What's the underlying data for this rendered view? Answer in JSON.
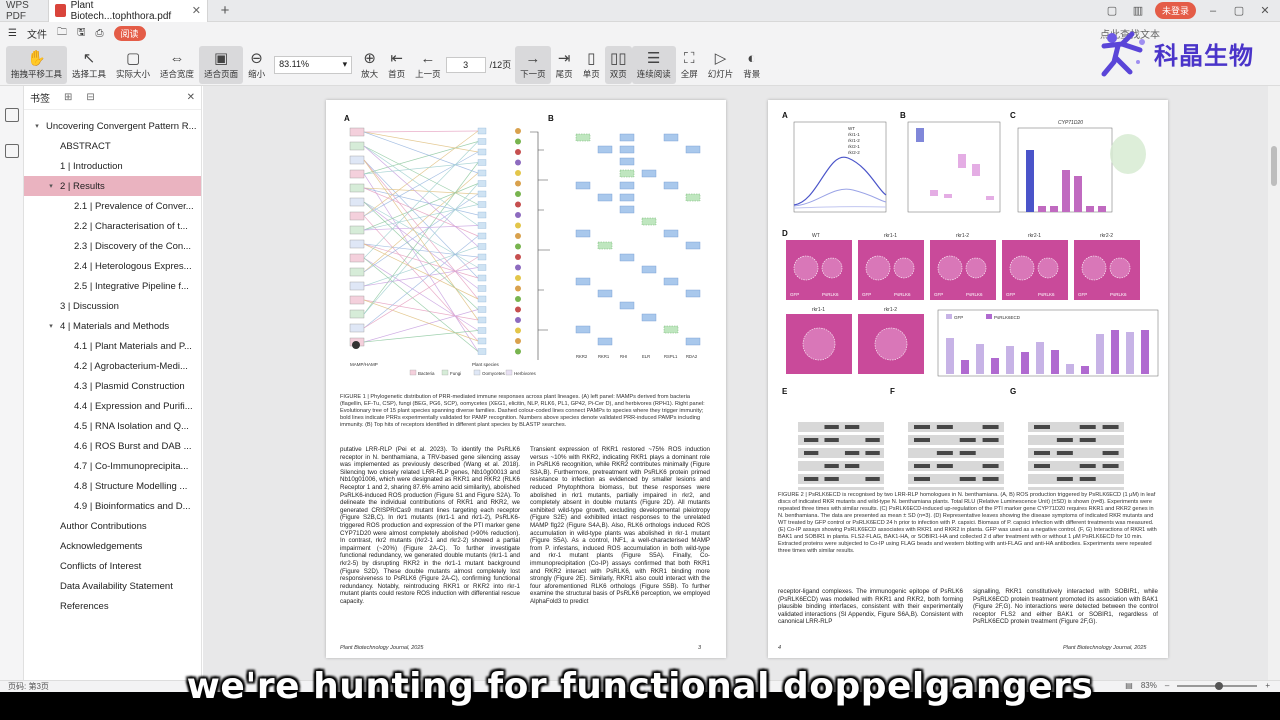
{
  "tabbar": {
    "app_label": "WPS PDF",
    "doc_tab": "Plant Biotech...tophthora.pdf",
    "login": "未登录"
  },
  "menubar": {
    "file": "文件",
    "read_mode": "阅读",
    "right_search": "点此查找文本"
  },
  "toolbar": {
    "tools": [
      {
        "name": "hand-tool",
        "glyph": "✋",
        "label": "拖拽平移工具",
        "active": true
      },
      {
        "name": "select-tool",
        "glyph": "↖",
        "label": "选择工具"
      },
      {
        "name": "actual-size",
        "glyph": "▢",
        "label": "实际大小"
      },
      {
        "name": "fit-width",
        "glyph": "⇔",
        "label": "适合宽度"
      },
      {
        "name": "fit-page",
        "glyph": "▣",
        "label": "适合页面",
        "active": true
      },
      {
        "name": "zoom-out",
        "glyph": "⊖",
        "label": "缩小"
      }
    ],
    "zoom_value": "83.11%",
    "tools2": [
      {
        "name": "zoom-in",
        "glyph": "⊕",
        "label": "放大"
      },
      {
        "name": "first-page",
        "glyph": "⇤",
        "label": "首页"
      },
      {
        "name": "prev-page",
        "glyph": "←",
        "label": "上一页"
      }
    ],
    "page_current": "3",
    "page_total": "/12页",
    "tools3": [
      {
        "name": "next-page",
        "glyph": "→",
        "label": "下一页",
        "active": true
      },
      {
        "name": "last-page",
        "glyph": "⇥",
        "label": "尾页"
      },
      {
        "name": "single-page",
        "glyph": "▯",
        "label": "单页"
      },
      {
        "name": "double-page",
        "glyph": "▯▯",
        "label": "双页",
        "active": true
      },
      {
        "name": "continuous",
        "glyph": "☰",
        "label": "连续阅读",
        "active": true
      },
      {
        "name": "fullscreen",
        "glyph": "⛶",
        "label": "全屏"
      },
      {
        "name": "slideshow",
        "glyph": "▷",
        "label": "幻灯片"
      },
      {
        "name": "background",
        "glyph": "◐",
        "label": "背景"
      }
    ]
  },
  "logo": {
    "text": "科晶生物"
  },
  "bookmarks": {
    "header": "书签",
    "items": [
      {
        "label": "Uncovering Convergent Pattern R...",
        "level": 0,
        "arrow": "▾"
      },
      {
        "label": "ABSTRACT",
        "level": 1
      },
      {
        "label": "1  |  Introduction",
        "level": 1
      },
      {
        "label": "2  |  Results",
        "level": 1,
        "arrow": "▾",
        "selected": true
      },
      {
        "label": "2.1  |  Prevalence of Conver...",
        "level": 2
      },
      {
        "label": "2.2  |  Characterisation of t...",
        "level": 2
      },
      {
        "label": "2.3  |  Discovery of the Con...",
        "level": 2
      },
      {
        "label": "2.4  |  Heterologous Expres...",
        "level": 2
      },
      {
        "label": "2.5  |  Integrative Pipeline f...",
        "level": 2
      },
      {
        "label": "3  |  Discussion",
        "level": 1
      },
      {
        "label": "4  |  Materials and Methods",
        "level": 1,
        "arrow": "▾"
      },
      {
        "label": "4.1  |  Plant Materials and P...",
        "level": 2
      },
      {
        "label": "4.2  |  Agrobacterium-Medi...",
        "level": 2
      },
      {
        "label": "4.3  |  Plasmid Construction",
        "level": 2
      },
      {
        "label": "4.4  |  Expression and Purifi...",
        "level": 2
      },
      {
        "label": "4.5  |  RNA Isolation and Q...",
        "level": 2
      },
      {
        "label": "4.6  |  ROS Burst and DAB ...",
        "level": 2
      },
      {
        "label": "4.7  |  Co-Immunoprecipita...",
        "level": 2
      },
      {
        "label": "4.8  |  Structure Modelling ...",
        "level": 2
      },
      {
        "label": "4.9  |  Bioinformatics and D...",
        "level": 2
      },
      {
        "label": "Author Contributions",
        "level": 1
      },
      {
        "label": "Acknowledgements",
        "level": 1
      },
      {
        "label": "Conflicts of Interest",
        "level": 1
      },
      {
        "label": "Data Availability Statement",
        "level": 1
      },
      {
        "label": "References",
        "level": 1
      }
    ]
  },
  "page_left": {
    "panel_a": "A",
    "panel_b": "B",
    "fig_caption": "FIGURE 1  |  Phylogenetic distribution of PRR-mediated immune responses across plant lineages. (A) left panel: MAMPs derived from bacteria (flagellin, EF-Tu, CSP), fungi (BEG, PG6, SCP), oomycetes (XEG1, elicitin, NLP, RLK6, PL1, GP42, Pi-Cer D), and herbivores (RPH1). Right panel: Evolutionary tree of 15 plant species spanning diverse families. Dashed colour-coded lines connect PAMPs to species where they trigger immunity; bold lines indicate PRRs experimentally validated for PAMP recognition. Numbers above species denote validated PRR-induced PAMPs including immunity. (B) Top hits of receptors identified in different plant species by BLASTP searches.",
    "col1": "putative LRR-RLP (Pei et al. 2023). To identify the PsRLK6 receptor in N. benthamiana, a TRV-based gene silencing assay was implemented as previously described (Wang et al. 2018). Silencing two closely related LRR-RLP genes, Nb10g00013 and Nb10g01006, which were designated as RKR1 and RKR2 (RLK6 Receptor 1 and 2, sharing 87.6% amino acid similarity), abolished PsRLK6-induced ROS production (Figure S1 and Figure S2A). To delineate the individual contributions of RKR1 and RKR2, we generated CRISPR/Cas9 mutant lines targeting each receptor (Figure S2B,C). In rkr1 mutants (rkr1-1 and rkr1-2), PsRLK6-triggered ROS production and expression of the PTI marker gene CYP71D20 were almost completely abolished (>90% reduction). In contrast, rkr2 mutants (rkr2-1 and rkr2-2) showed a partial impairment (~20%) (Figure 2A-C). To further investigate functional redundancy, we generated double mutants (rkr1-1 and rkr2-5) by disrupting RKR2 in the rkr1-1 mutant background (Figure S2D). These double mutants almost completely lost responsiveness to PsRLK6 (Figure 2A-C), confirming functional redundancy. Notably, reintroducing RKR1 or RKR2 into rkr-1 mutant plants could restore ROS induction with differential rescue capacity.",
    "col2": "Transient expression of RKR1 restored ~75% ROS induction versus ~10% with RKR2, indicating RKR1 plays a dominant role in PsRLK6 recognition, while RKR2 contributes minimally (Figure S3A,B). Furthermore, pretreatment with PsRLK6 protein primed resistance to infection as evidenced by smaller lesions and reduced Phytophthora biomass, but these responses were abolished in rkr1 mutants, partially impaired in rkr2, and completely absent in double mutants (Figure 2D). All mutants exhibited wild-type growth, excluding developmental pleiotropy (Figure S2E) and exhibited intact responses to the unrelated MAMP flg22 (Figure S4A,B). Also, RLK6 orthologs induced ROS accumulation in wild-type plants was abolished in rkr-1 mutant (Figure S5A). As a control, INF1, a well-characterised MAMP from P. infestans, induced ROS accumulation in both wild-type and rkr-1 mutant plants (Figure S5A). Finally, Co-immunoprecipitation (Co-IP) assays confirmed that both RKR1 and RKR2 interact with PsRLK6, with RKR1 binding more strongly (Figure 2E). Similarly, RKR1 also could interact with the four aforementioned RLK6 orthologs (Figure S5B). To further examine the structural basis of PsRLK6 perception, we employed AlphaFold3 to predict",
    "footer_journal": "Plant Biotechnology Journal, 2025",
    "footer_num": "3",
    "legend_items": [
      "Bacteria",
      "Fungi",
      "Oomycetes",
      "Herbivores"
    ],
    "xaxis_labels": [
      "RKR2",
      "RKR1",
      "RHI",
      "ELR",
      "RSPL1",
      "RDA2"
    ],
    "mamp_label": "MAMP/HAMP",
    "species_label": "Plant species"
  },
  "page_right": {
    "panel_labels": [
      "A",
      "B",
      "C",
      "D",
      "E",
      "F",
      "G"
    ],
    "fig_caption": "FIGURE 2  |  PsRLK6ECD is recognised by two LRR-RLP homologues in N. benthamiana. (A, B) ROS production triggered by PsRLK6ECD (1 μM) in leaf discs of indicated RKR mutants and wild-type N. benthamiana plants. Total RLU (Relative Luminescence Unit) (±SD) is shown (n=8). Experiments were repeated three times with similar results. (C) PsRLK6ECD-induced up-regulation of the PTI marker gene CYP71D20 requires RKR1 and RKR2 genes in N. benthamiana. The data are presented as mean ± SD (n=3). (D) Representative leaves showing the disease symptoms of indicated RKR mutants and WT treated by GFP control or PsRLK6ECD 24 h prior to infection with P. capsici. Biomass of P. capsici infection with different treatments was measured. (E) Co-IP assays showing PsRLK6ECD associates with RKR1 and RKR2 in planta. GFP was used as a negative control. (F, G) Interactions of RKR1 with BAK1 and SOBIR1 in planta. FLS2-FLAG, BAK1-HA, or SOBIR1-HA and collected 2 d after treatment with or without 1 μM PsRLK6ECD for 10 min. Extracted proteins were subjected to Co-IP using FLAG beads and western blotting with anti-FLAG and anti-HA antibodies. Experiments were repeated three times with similar results.",
    "col1": "receptor-ligand complexes. The immunogenic epitope of PsRLK6 (PsRLK6ECD) was modelled with RKR1 and RKR2, both forming plausible binding interfaces, consistent with their experimentally validated interactions (SI Appendix, Figure S6A,B). Consistent with canonical LRR-RLP",
    "col2": "signalling, RKR1 constitutively interacted with SOBIR1, while PsRLK6ECD protein treatment promoted its association with BAK1 (Figure 2F,G). No interactions were detected between the control receptor FLS2 and either BAK1 or SOBIR1, regardless of PsRLK6ECD protein treatment (Figure 2F,G).",
    "footer_journal": "Plant Biotechnology Journal, 2025",
    "footer_num": "4",
    "gene_label": "CYP71D20",
    "legend_ros": [
      "WT",
      "rkr1-1",
      "rkr1-2",
      "rkr2-1",
      "rkr2-2"
    ],
    "legend_bar": [
      "GFP",
      "PsRLK6ECD"
    ],
    "leaf_labels": [
      "WT",
      "rkr1-1",
      "rkr1-2",
      "rkr2-1",
      "rkr2-2",
      "rkr1-1",
      "rkr1-2"
    ],
    "leaf_text_a": "GFP",
    "leaf_text_b": "PsRLK6"
  },
  "statusbar": {
    "left": "页码: 第3页",
    "zoom": "83%"
  },
  "subtitle": "we're hunting for functional doppelgangers",
  "colors": {
    "accent_red": "#e45c47",
    "selection_pink": "#eab3c0",
    "logo_purple": "#4a34c9",
    "leaf_pink": "#d94fa1"
  }
}
